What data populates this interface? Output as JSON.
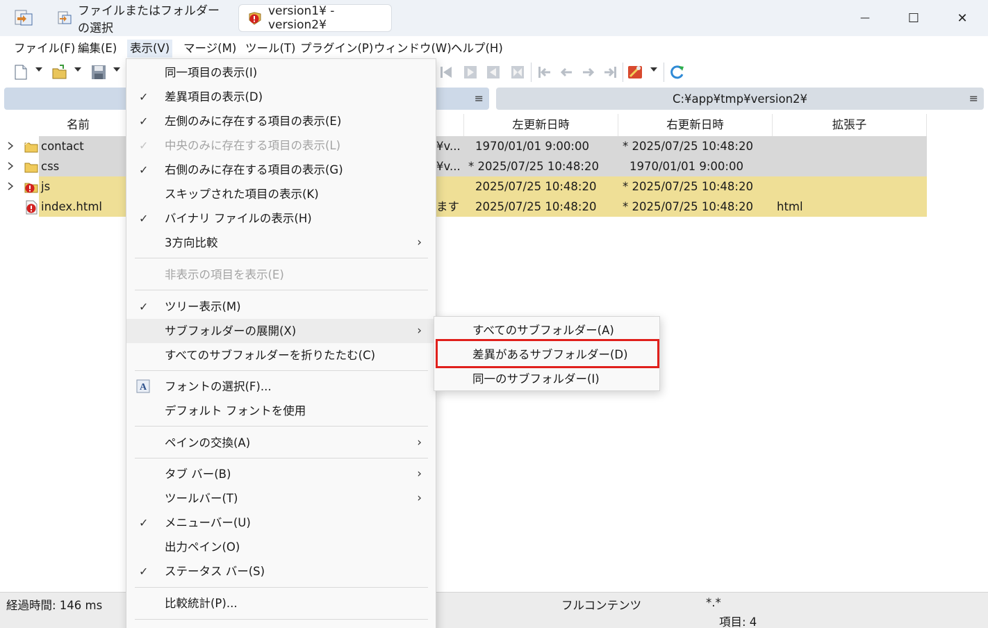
{
  "titlebar": {
    "tabs": [
      {
        "label": "ファイルまたはフォルダーの選択",
        "icon": "folder-select-icon"
      },
      {
        "label": "version1¥ - version2¥",
        "icon": "compare-diff-icon"
      }
    ],
    "minimize": "—",
    "maximize": "☐",
    "close": "✕"
  },
  "menubar": {
    "items": [
      "ファイル(F)",
      "編集(E)",
      "表示(V)",
      "マージ(M)",
      "ツール(T)",
      "プラグイン(P)",
      "ウィンドウ(W)",
      "ヘルプ(H)"
    ]
  },
  "paths": {
    "left": "",
    "right": "C:¥app¥tmp¥version2¥",
    "menu_glyph": "≡"
  },
  "columns": {
    "name": "名前",
    "left_date": "左更新日時",
    "right_date": "右更新日時",
    "ext": "拡張子"
  },
  "rows": [
    {
      "name": "contact",
      "middle": "¥v...",
      "left_date": "1970/01/01 9:00:00",
      "right_date": "* 2025/07/25 10:48:20",
      "ext": "",
      "color": "#d8d8d8",
      "icon": "folder-icon"
    },
    {
      "name": "css",
      "middle": "¥v...",
      "left_date": "* 2025/07/25 10:48:20",
      "right_date": "1970/01/01 9:00:00",
      "ext": "",
      "color": "#d8d8d8",
      "icon": "folder-icon"
    },
    {
      "name": "js",
      "middle": "",
      "left_date": "2025/07/25 10:48:20",
      "right_date": "* 2025/07/25 10:48:20",
      "ext": "",
      "color": "#efdf96",
      "icon": "folder-diff-icon"
    },
    {
      "name": "index.html",
      "middle": "ます",
      "left_date": "2025/07/25 10:48:20",
      "right_date": "* 2025/07/25 10:48:20",
      "ext": "html",
      "color": "#efdf96",
      "icon": "file-diff-icon"
    }
  ],
  "view_menu": {
    "items": [
      {
        "label": "同一項目の表示(I)",
        "checked": false,
        "disabled": false,
        "submenu": false
      },
      {
        "label": "差異項目の表示(D)",
        "checked": true,
        "disabled": false,
        "submenu": false
      },
      {
        "label": "左側のみに存在する項目の表示(E)",
        "checked": true,
        "disabled": false,
        "submenu": false
      },
      {
        "label": "中央のみに存在する項目の表示(L)",
        "checked": true,
        "disabled": true,
        "submenu": false
      },
      {
        "label": "右側のみに存在する項目の表示(G)",
        "checked": true,
        "disabled": false,
        "submenu": false
      },
      {
        "label": "スキップされた項目の表示(K)",
        "checked": false,
        "disabled": false,
        "submenu": false
      },
      {
        "label": "バイナリ ファイルの表示(H)",
        "checked": true,
        "disabled": false,
        "submenu": false
      },
      {
        "label": "3方向比較",
        "checked": false,
        "disabled": false,
        "submenu": true
      },
      {
        "label": "非表示の項目を表示(E)",
        "checked": false,
        "disabled": true,
        "submenu": false
      },
      {
        "label": "ツリー表示(M)",
        "checked": true,
        "disabled": false,
        "submenu": false
      },
      {
        "label": "サブフォルダーの展開(X)",
        "checked": false,
        "disabled": false,
        "submenu": true
      },
      {
        "label": "すべてのサブフォルダーを折りたたむ(C)",
        "checked": false,
        "disabled": false,
        "submenu": false
      },
      {
        "label": "フォントの選択(F)...",
        "checked": false,
        "disabled": false,
        "submenu": false
      },
      {
        "label": "デフォルト フォントを使用",
        "checked": false,
        "disabled": false,
        "submenu": false
      },
      {
        "label": "ペインの交換(A)",
        "checked": false,
        "disabled": false,
        "submenu": true
      },
      {
        "label": "タブ バー(B)",
        "checked": false,
        "disabled": false,
        "submenu": true
      },
      {
        "label": "ツールバー(T)",
        "checked": false,
        "disabled": false,
        "submenu": true
      },
      {
        "label": "メニューバー(U)",
        "checked": true,
        "disabled": false,
        "submenu": false
      },
      {
        "label": "出力ペイン(O)",
        "checked": false,
        "disabled": false,
        "submenu": false
      },
      {
        "label": "ステータス バー(S)",
        "checked": true,
        "disabled": false,
        "submenu": false
      },
      {
        "label": "比較統計(P)...",
        "checked": false,
        "disabled": false,
        "submenu": false
      }
    ],
    "check_glyph": "✓",
    "chevron_glyph": "›"
  },
  "expand_submenu": {
    "items": [
      "すべてのサブフォルダー(A)",
      "差異があるサブフォルダー(D)",
      "同一のサブフォルダー(I)"
    ]
  },
  "status": {
    "elapsed": "経過時間: 146 ms",
    "compare_method": "フルコンテンツ",
    "filter": "*.*",
    "items": "項目: 4"
  }
}
